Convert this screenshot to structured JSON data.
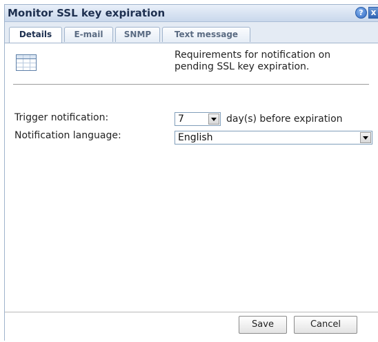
{
  "dialog": {
    "title": "Monitor SSL key expiration",
    "help_icon": "?",
    "close_icon": "x"
  },
  "tabs": [
    {
      "label": "Details",
      "active": true
    },
    {
      "label": "E-mail",
      "active": false
    },
    {
      "label": "SNMP",
      "active": false
    },
    {
      "label": "Text message",
      "active": false
    }
  ],
  "details": {
    "icon": "table-icon",
    "description": "Requirements for notification on pending SSL key expiration.",
    "trigger_label": "Trigger notification:",
    "trigger_value": "7",
    "trigger_suffix": "day(s) before expiration",
    "language_label": "Notification language:",
    "language_value": "English"
  },
  "footer": {
    "save_label": "Save",
    "cancel_label": "Cancel"
  },
  "colors": {
    "titlebar": "#c9d8ec",
    "title_text": "#1d2f4f",
    "border": "#9fb3cc"
  }
}
